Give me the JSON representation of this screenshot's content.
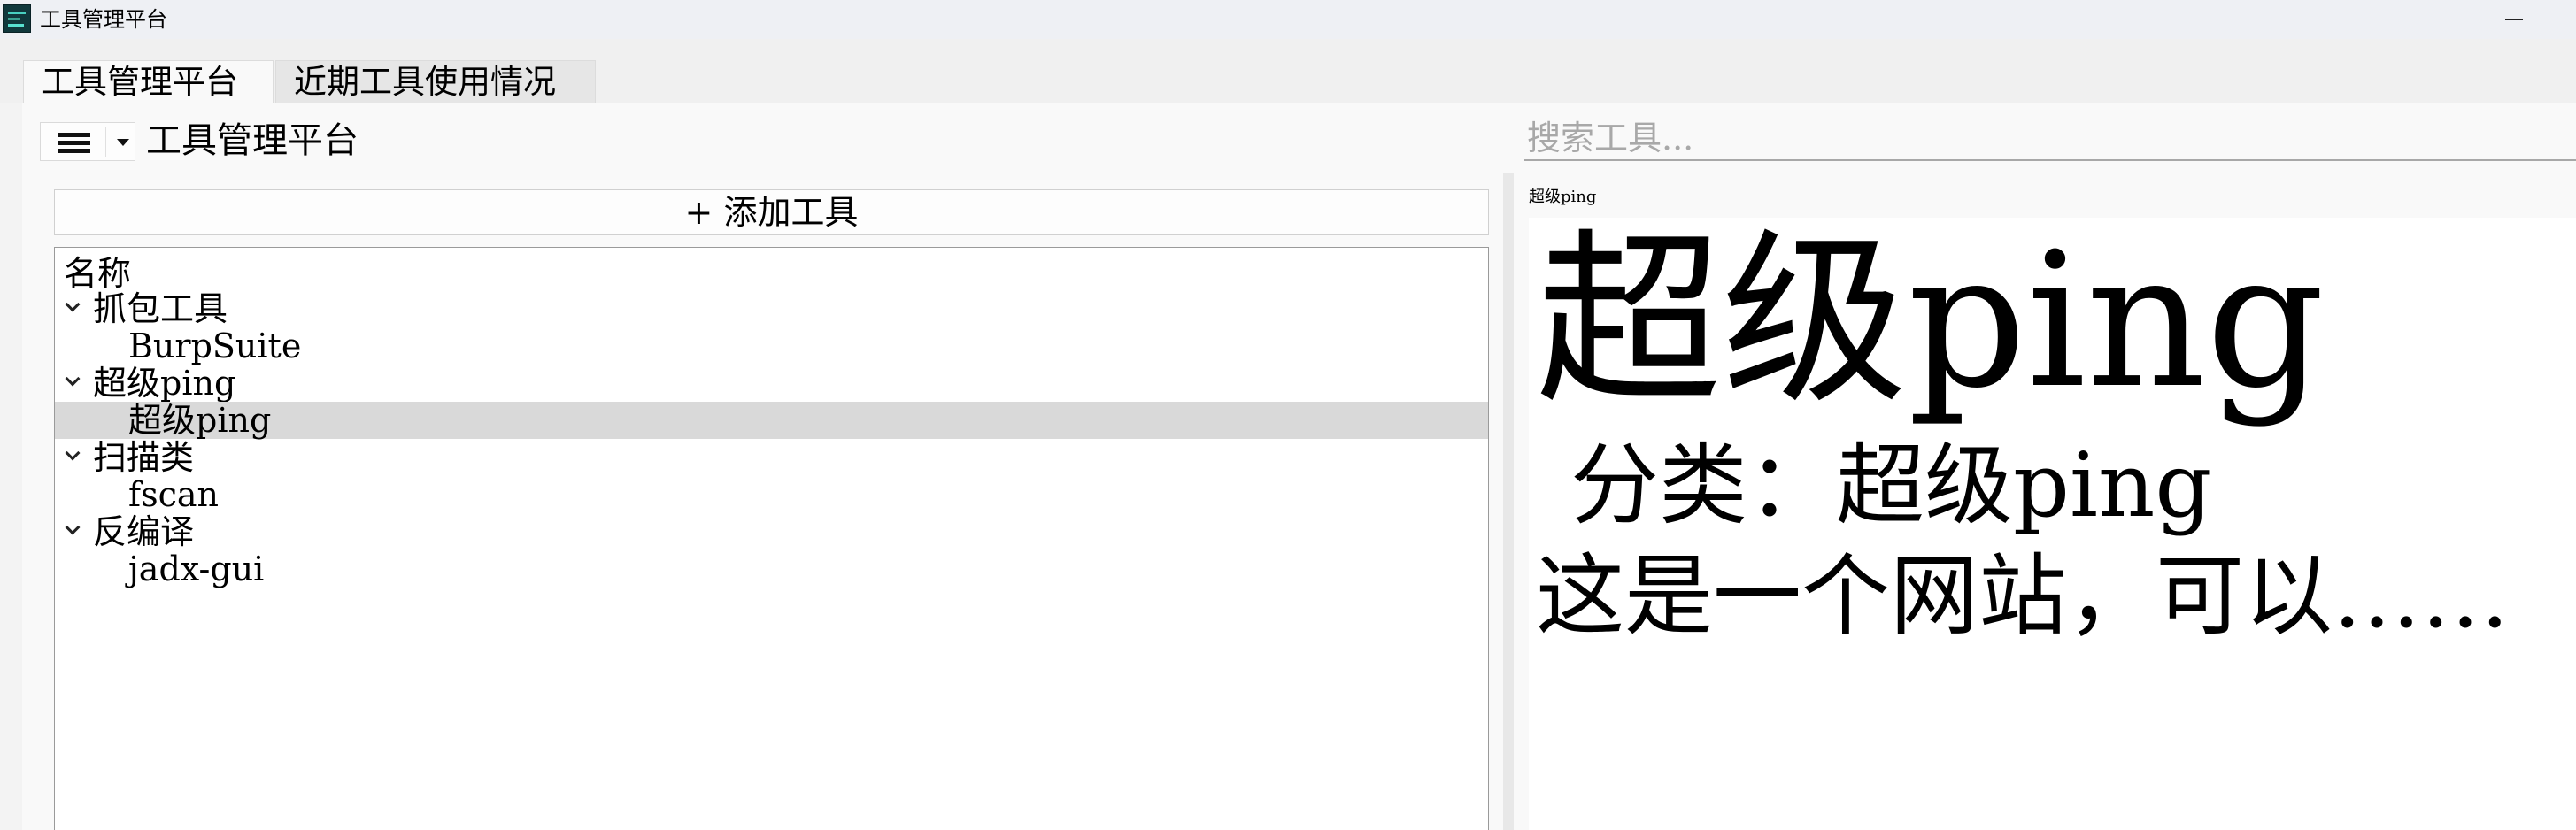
{
  "window": {
    "title": "工具管理平台"
  },
  "tabs": [
    {
      "label": "工具管理平台",
      "active": true
    },
    {
      "label": "近期工具使用情况",
      "active": false
    }
  ],
  "left_panel": {
    "heading": "工具管理平台",
    "add_button_label": "+ 添加工具",
    "tree": {
      "header": "名称",
      "groups": [
        {
          "label": "抓包工具",
          "expanded": true,
          "items": [
            {
              "label": "BurpSuite",
              "selected": false
            }
          ]
        },
        {
          "label": "超级ping",
          "expanded": true,
          "items": [
            {
              "label": "超级ping",
              "selected": true
            }
          ]
        },
        {
          "label": "扫描类",
          "expanded": true,
          "items": [
            {
              "label": "fscan",
              "selected": false
            }
          ]
        },
        {
          "label": "反编译",
          "expanded": true,
          "items": [
            {
              "label": "jadx-gui",
              "selected": false
            }
          ]
        }
      ]
    }
  },
  "search": {
    "placeholder": "搜索工具...",
    "value": ""
  },
  "detail": {
    "caption": "超级ping",
    "title": "超级ping",
    "category_line": "分类：超级ping",
    "description": "这是一个网站，可以……"
  },
  "icons": {
    "menu": "hamburger-icon",
    "dropdown": "caret-down-icon",
    "expand": "chevron-down-icon",
    "window_minimize": "minimize-icon"
  },
  "colors": {
    "selection": "#d9d9d9",
    "panel_bg": "#f9f9f9",
    "titlebar_bg": "#eef0f4"
  }
}
